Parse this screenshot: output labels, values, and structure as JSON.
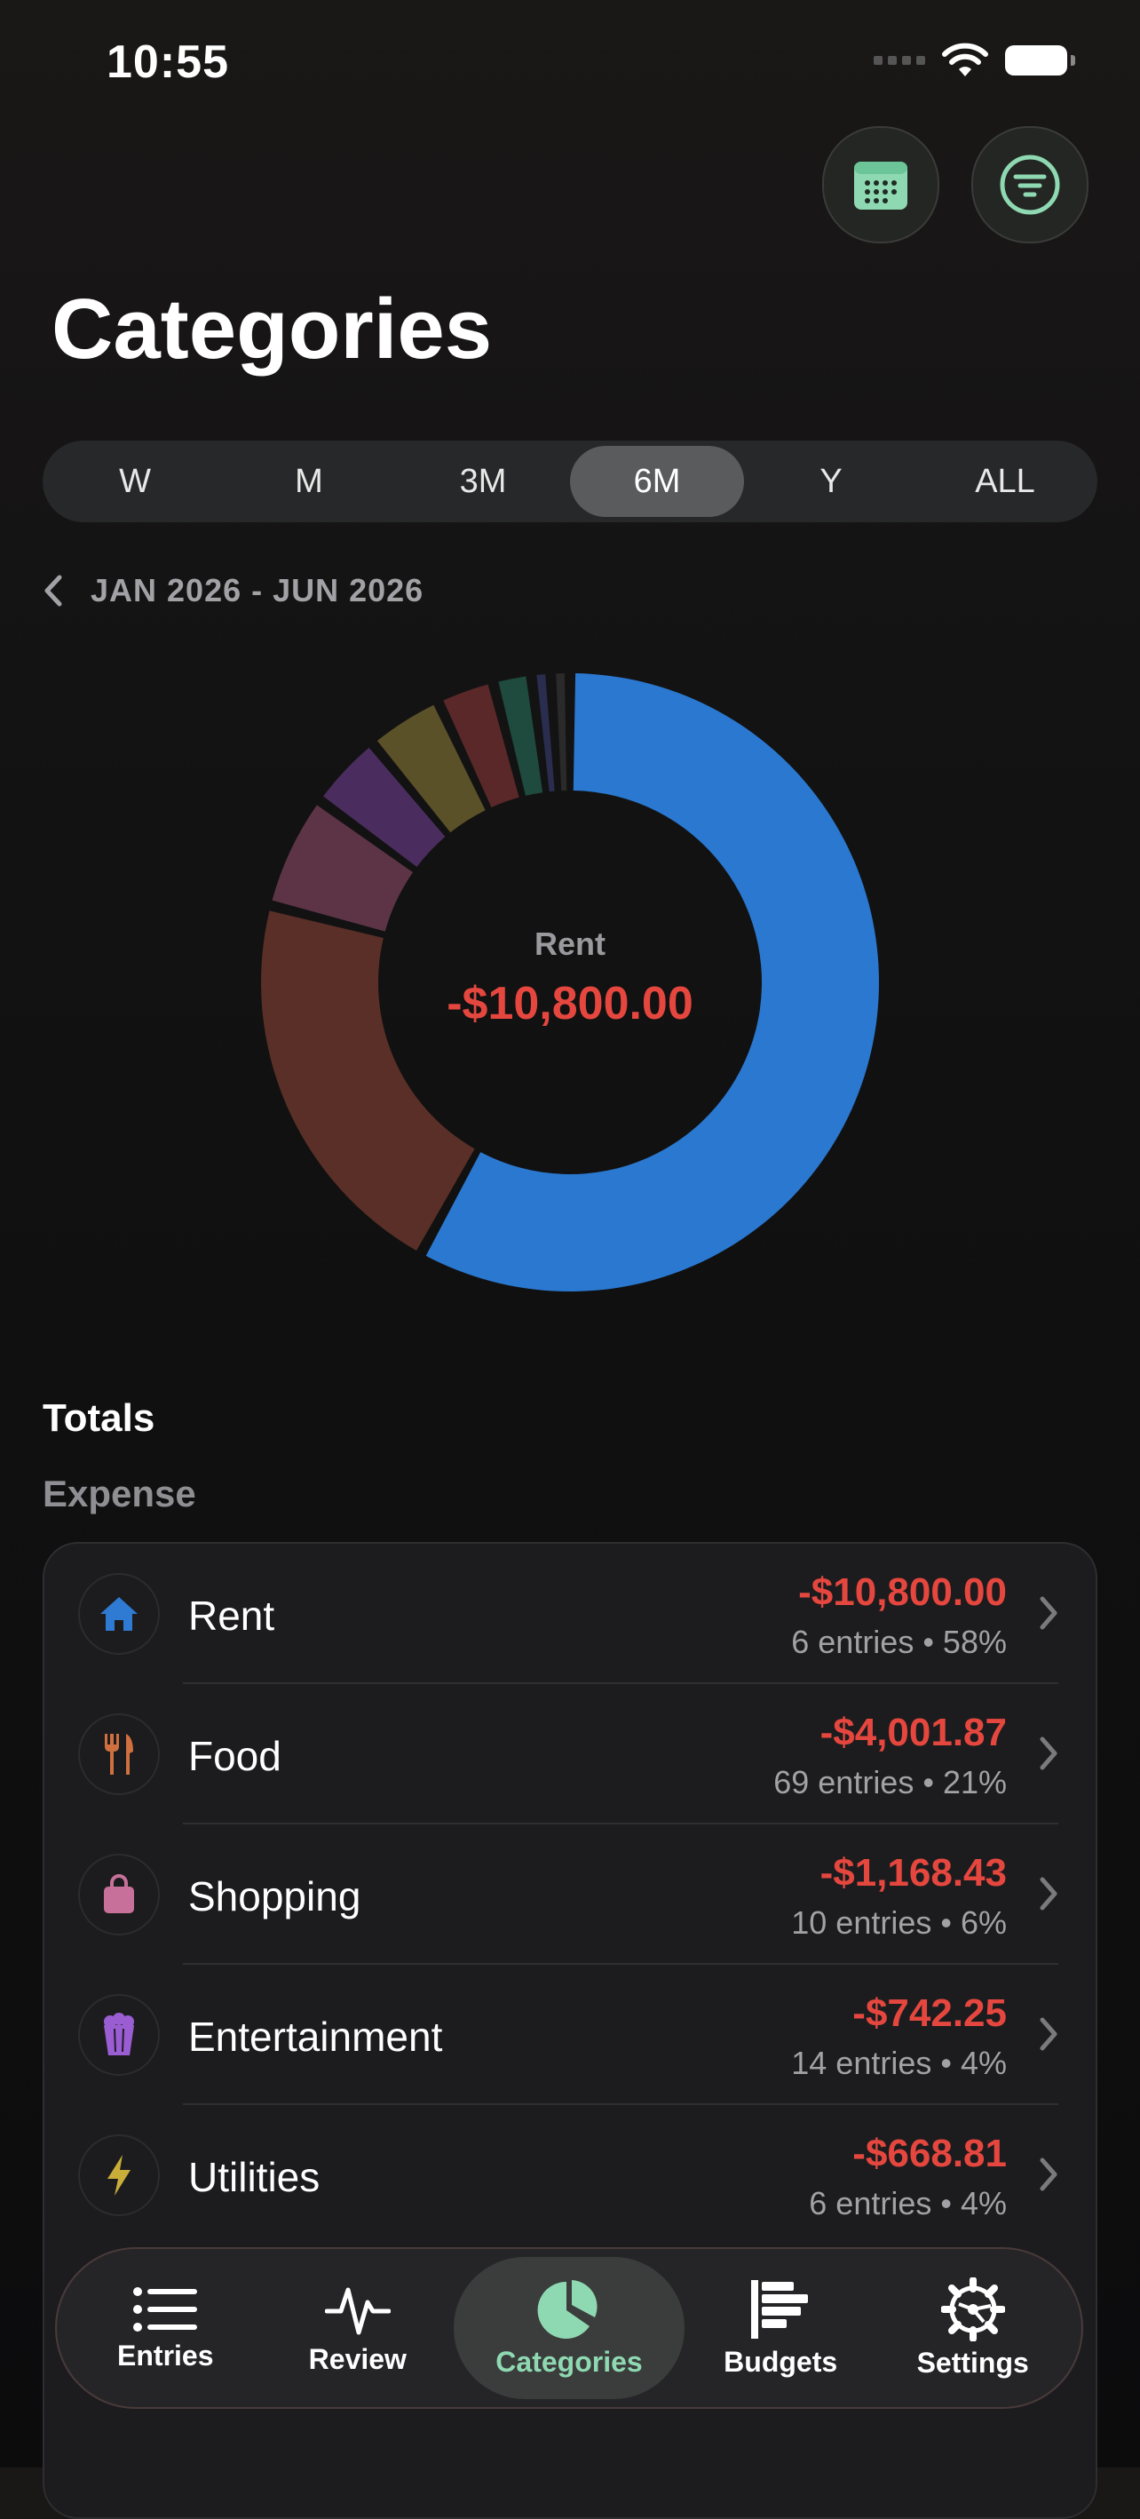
{
  "status_bar": {
    "time": "10:55"
  },
  "header": {
    "title": "Categories"
  },
  "segments": [
    {
      "label": "W",
      "active": false
    },
    {
      "label": "M",
      "active": false
    },
    {
      "label": "3M",
      "active": false
    },
    {
      "label": "6M",
      "active": true
    },
    {
      "label": "Y",
      "active": false
    },
    {
      "label": "ALL",
      "active": false
    }
  ],
  "date_range": "JAN 2026 - JUN 2026",
  "donut": {
    "center_label": "Rent",
    "center_value": "-$10,800.00",
    "segments_pct": [
      58,
      21,
      6,
      4,
      4,
      3,
      2,
      1,
      1
    ],
    "segment_colors": [
      "#2a78d0",
      "#5a2f27",
      "#5c3446",
      "#4a2d5e",
      "#5b5128",
      "#5a2828",
      "#1f4a3e",
      "#2b2d4f",
      "#2a2a2a"
    ]
  },
  "totals_heading": "Totals",
  "expense_heading": "Expense",
  "expense_rows": [
    {
      "name": "Rent",
      "amount": "-$10,800.00",
      "meta": "6 entries • 58%",
      "icon": "house-icon",
      "color": "#2f7ad3",
      "bg": "#16243a"
    },
    {
      "name": "Food",
      "amount": "-$4,001.87",
      "meta": "69 entries • 21%",
      "icon": "fork-knife-icon",
      "color": "#d0703e",
      "bg": "#2a1d18"
    },
    {
      "name": "Shopping",
      "amount": "-$1,168.43",
      "meta": "10 entries • 6%",
      "icon": "shopping-bag-icon",
      "color": "#c7709a",
      "bg": "#2a1d24"
    },
    {
      "name": "Entertainment",
      "amount": "-$742.25",
      "meta": "14 entries • 4%",
      "icon": "popcorn-icon",
      "color": "#9a5ed2",
      "bg": "#231a2e"
    },
    {
      "name": "Utilities",
      "amount": "-$668.81",
      "meta": "6 entries • 4%",
      "icon": "bolt-icon",
      "color": "#c9ae3a",
      "bg": "#25221a"
    }
  ],
  "tabs": [
    {
      "label": "Entries",
      "icon": "list-icon",
      "active": false
    },
    {
      "label": "Review",
      "icon": "pulse-icon",
      "active": false
    },
    {
      "label": "Categories",
      "icon": "pie-chart-icon",
      "active": true
    },
    {
      "label": "Budgets",
      "icon": "bars-icon",
      "active": false
    },
    {
      "label": "Settings",
      "icon": "gear-icon",
      "active": false
    }
  ],
  "colors": {
    "accent": "#8fd9b2",
    "expense": "#e5473f"
  }
}
